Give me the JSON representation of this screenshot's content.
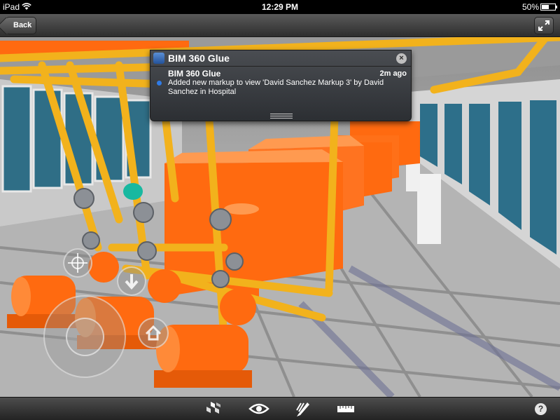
{
  "status_bar": {
    "carrier": "iPad",
    "time": "12:29 PM",
    "battery": "50%",
    "battery_level": 0.5
  },
  "top_bar": {
    "back_label": "Back",
    "fullscreen_icon": "expand-arrows-icon"
  },
  "notification": {
    "app_name": "BIM 360 Glue",
    "app_icon": "bim360-app-icon",
    "title": "BIM 360 Glue",
    "time": "2m ago",
    "message": "Added new markup to view 'David Sanchez Markup 3' by David Sanchez in Hospital",
    "unread_color": "#2f7be6"
  },
  "viewer": {
    "scene": "3D mechanical room model",
    "pipe_color": "#f2b21c",
    "equipment_color": "#ff6a10",
    "controls": [
      "crosshair-icon",
      "down-arrow-icon",
      "home-icon",
      "joystick"
    ]
  },
  "toolbar": {
    "items": [
      "model-browser-icon",
      "views-eye-icon",
      "markup-pen-icon",
      "measure-ruler-icon"
    ],
    "help_label": "?"
  }
}
